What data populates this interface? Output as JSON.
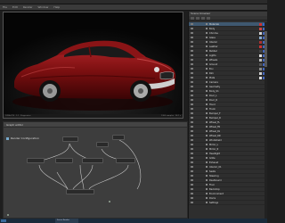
{
  "app": {
    "menu": [
      "File",
      "Edit",
      "Render",
      "Window",
      "Help"
    ]
  },
  "viewport": {
    "status_left": "1280x720 · 1:1 · Progressive",
    "status_right": "1360 samples · 24.1 s"
  },
  "nodegraph": {
    "title": "Graph editor",
    "subtitle": "Render Configuration"
  },
  "scene": {
    "title": "Scene browser",
    "rows": [
      {
        "label": "Materials",
        "swatches": [
          "#cc3333",
          "#3366cc"
        ],
        "selected": true
      },
      {
        "label": "Body",
        "swatches": [
          "#cc4444",
          "#4466bb"
        ],
        "selected": false
      },
      {
        "label": "Chrome",
        "swatches": [
          "#d0d0d0",
          "#4466bb"
        ],
        "selected": false
      },
      {
        "label": "Glass",
        "swatches": [
          "#88aacc",
          "#4466bb"
        ],
        "selected": false
      },
      {
        "label": "Interior",
        "swatches": [
          "#aa3333",
          "#4466bb"
        ],
        "selected": false
      },
      {
        "label": "Leather",
        "swatches": [
          "#cc3333",
          "#4466bb"
        ],
        "selected": false
      },
      {
        "label": "Rubber",
        "swatches": [
          "#444444",
          "#4466bb"
        ],
        "selected": false
      },
      {
        "label": "Lights",
        "swatches": [
          "#dddddd",
          "#4466bb"
        ],
        "selected": false
      },
      {
        "label": "Wheels",
        "swatches": [
          "#bbbbbb",
          "#4466bb"
        ],
        "selected": false
      },
      {
        "label": "Ground",
        "swatches": [
          "#555555",
          "#4466bb"
        ],
        "selected": false
      },
      {
        "label": "Env",
        "swatches": [
          "#888888",
          "#4466bb"
        ],
        "selected": false
      },
      {
        "label": "Rim",
        "swatches": [
          "#cccccc",
          "#4466bb"
        ],
        "selected": false
      },
      {
        "label": "Plate",
        "swatches": [
          "#dddddd",
          "#4466bb"
        ],
        "selected": false
      },
      {
        "label": "Camera",
        "swatches": [],
        "selected": false
      },
      {
        "label": "Geometry",
        "swatches": [],
        "selected": false
      },
      {
        "label": "Body_01",
        "swatches": [],
        "selected": false
      },
      {
        "label": "Door_L",
        "swatches": [],
        "selected": false
      },
      {
        "label": "Door_R",
        "swatches": [],
        "selected": false
      },
      {
        "label": "Hood",
        "swatches": [],
        "selected": false
      },
      {
        "label": "Trunk",
        "swatches": [],
        "selected": false
      },
      {
        "label": "Bumper_F",
        "swatches": [],
        "selected": false
      },
      {
        "label": "Bumper_R",
        "swatches": [],
        "selected": false
      },
      {
        "label": "Wheel_FL",
        "swatches": [],
        "selected": false
      },
      {
        "label": "Wheel_FR",
        "swatches": [],
        "selected": false
      },
      {
        "label": "Wheel_RL",
        "swatches": [],
        "selected": false
      },
      {
        "label": "Wheel_RR",
        "swatches": [],
        "selected": false
      },
      {
        "label": "Windshield",
        "swatches": [],
        "selected": false
      },
      {
        "label": "Mirror_L",
        "swatches": [],
        "selected": false
      },
      {
        "label": "Mirror_R",
        "swatches": [],
        "selected": false
      },
      {
        "label": "Headlight",
        "swatches": [],
        "selected": false
      },
      {
        "label": "Grille",
        "swatches": [],
        "selected": false
      },
      {
        "label": "Exhaust",
        "swatches": [],
        "selected": false
      },
      {
        "label": "Interior_01",
        "swatches": [],
        "selected": false
      },
      {
        "label": "Seats",
        "swatches": [],
        "selected": false
      },
      {
        "label": "Steering",
        "swatches": [],
        "selected": false
      },
      {
        "label": "Dashboard",
        "swatches": [],
        "selected": false
      },
      {
        "label": "Floor",
        "swatches": [],
        "selected": false
      },
      {
        "label": "Backdrop",
        "swatches": [],
        "selected": false
      },
      {
        "label": "Environment",
        "swatches": [],
        "selected": false
      },
      {
        "label": "Dome",
        "swatches": [],
        "selected": false
      },
      {
        "label": "Settings",
        "swatches": [],
        "selected": false
      }
    ]
  },
  "taskbar": {
    "task_label": "Scene Render"
  },
  "colors": {
    "car_body": "#7a0f10",
    "selection": "#3f5870",
    "graph_bg": "#3d3d3d"
  }
}
